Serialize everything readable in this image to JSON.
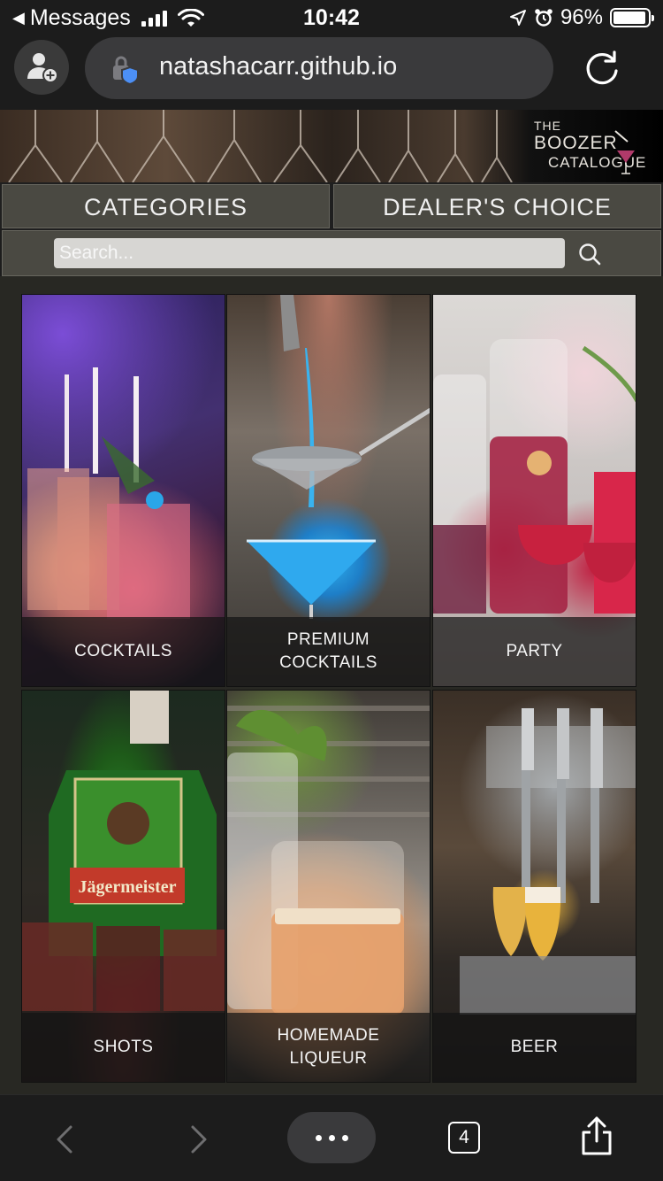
{
  "status_bar": {
    "back_app": "Messages",
    "time": "10:42",
    "battery_percent": "96%",
    "battery_level": 0.96,
    "signal_bars": 4,
    "icons": [
      "back-arrow-icon",
      "signal-icon",
      "wifi-icon",
      "location-icon",
      "alarm-icon",
      "battery-icon"
    ]
  },
  "browser": {
    "url": "natashacarr.github.io",
    "icons": [
      "add-profile-icon",
      "lock-shield-icon",
      "reload-icon"
    ]
  },
  "site": {
    "logo": {
      "line1": "THE",
      "line2": "BOOZER",
      "line3": "CATALOGUE"
    },
    "nav": {
      "categories": "CATEGORIES",
      "dealers_choice": "DEALER'S CHOICE"
    },
    "search": {
      "placeholder": "Search...",
      "value": ""
    }
  },
  "categories": [
    {
      "label": "COCKTAILS"
    },
    {
      "label": "PREMIUM COCKTAILS"
    },
    {
      "label": "PARTY"
    },
    {
      "label": "SHOTS"
    },
    {
      "label": "HOMEMADE LIQUEUR"
    },
    {
      "label": "BEER"
    }
  ],
  "toolbar": {
    "tab_count": "4",
    "icons": [
      "back-chevron-icon",
      "forward-chevron-icon",
      "more-icon",
      "tabs-icon",
      "share-icon"
    ]
  },
  "colors": {
    "background": "#1c1c1c",
    "nav_button": "#4a4942",
    "content_bg": "#282823",
    "search_field": "#d7d6d3"
  }
}
